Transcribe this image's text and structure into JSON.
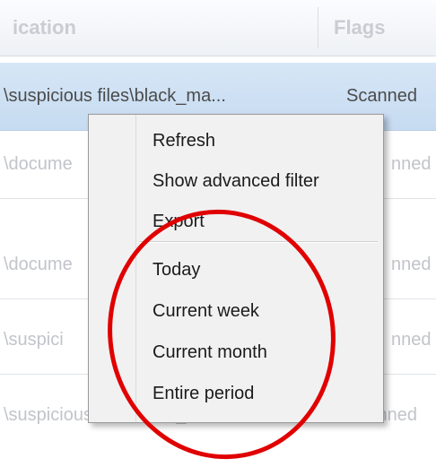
{
  "table": {
    "columns": {
      "location": "ication",
      "flags": "Flags"
    },
    "rows": [
      {
        "location": "\\suspicious files\\black_ma...",
        "flags": "Scanned",
        "selected": true
      },
      {
        "location": "\\docume",
        "flags": "nned",
        "selected": false
      },
      {
        "location": "\\docume",
        "flags": "nned",
        "selected": false
      },
      {
        "location": "\\suspici",
        "flags": "nned",
        "selected": false
      },
      {
        "location": "\\suspicious files\\black_ma...",
        "flags": "Scanned",
        "selected": false
      }
    ]
  },
  "context_menu": {
    "items": [
      {
        "label": "Refresh"
      },
      {
        "label": "Show advanced filter"
      },
      {
        "label": "Export"
      },
      {
        "label": "Today"
      },
      {
        "label": "Current week"
      },
      {
        "label": "Current month"
      },
      {
        "label": "Entire period"
      }
    ]
  },
  "annotation": {
    "shape": "ellipse",
    "color": "#e00000"
  },
  "colors": {
    "selected_row": "#c6dbf1",
    "menu_background": "#f1f1f1"
  }
}
